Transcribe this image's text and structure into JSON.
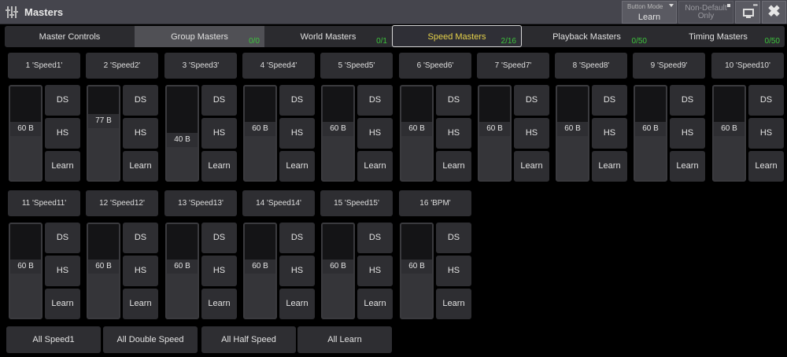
{
  "window": {
    "title": "Masters"
  },
  "toolbar": {
    "button_mode_label": "Button Mode",
    "button_mode_value": "Learn",
    "non_default_line1": "Non-Default",
    "non_default_line2": "Only",
    "close_label": "✖"
  },
  "tabs": [
    {
      "label": "Master Controls",
      "count": "",
      "state": "normal"
    },
    {
      "label": "Group Masters",
      "count": "0/0",
      "state": "gray"
    },
    {
      "label": "World Masters",
      "count": "0/1",
      "state": "normal"
    },
    {
      "label": "Speed Masters",
      "count": "2/16",
      "state": "active"
    },
    {
      "label": "Playback Masters",
      "count": "0/50",
      "state": "normal"
    },
    {
      "label": "Timing Masters",
      "count": "0/50",
      "state": "normal"
    }
  ],
  "masters": [
    {
      "name": "1 'Speed1'",
      "value": "60 B",
      "level": 0.55
    },
    {
      "name": "2 'Speed2'",
      "value": "77 B",
      "level": 0.65
    },
    {
      "name": "3 'Speed3'",
      "value": "40 B",
      "level": 0.42
    },
    {
      "name": "4 'Speed4'",
      "value": "60 B",
      "level": 0.55
    },
    {
      "name": "5 'Speed5'",
      "value": "60 B",
      "level": 0.55
    },
    {
      "name": "6 'Speed6'",
      "value": "60 B",
      "level": 0.55
    },
    {
      "name": "7 'Speed7'",
      "value": "60 B",
      "level": 0.55
    },
    {
      "name": "8 'Speed8'",
      "value": "60 B",
      "level": 0.55
    },
    {
      "name": "9 'Speed9'",
      "value": "60 B",
      "level": 0.55
    },
    {
      "name": "10 'Speed10'",
      "value": "60 B",
      "level": 0.55
    },
    {
      "name": "11 'Speed11'",
      "value": "60 B",
      "level": 0.55
    },
    {
      "name": "12 'Speed12'",
      "value": "60 B",
      "level": 0.55
    },
    {
      "name": "13 'Speed13'",
      "value": "60 B",
      "level": 0.55
    },
    {
      "name": "14 'Speed14'",
      "value": "60 B",
      "level": 0.55
    },
    {
      "name": "15 'Speed15'",
      "value": "60 B",
      "level": 0.55
    },
    {
      "name": "16 'BPM'",
      "value": "60 B",
      "level": 0.55
    }
  ],
  "master_buttons": {
    "ds": "DS",
    "hs": "HS",
    "learn": "Learn"
  },
  "bottom_buttons": [
    "All Speed1",
    "All Double Speed",
    "All Half Speed",
    "All Learn"
  ],
  "colors": {
    "count_green": "#3cc43c",
    "active_tab_text": "#e6d24a"
  }
}
